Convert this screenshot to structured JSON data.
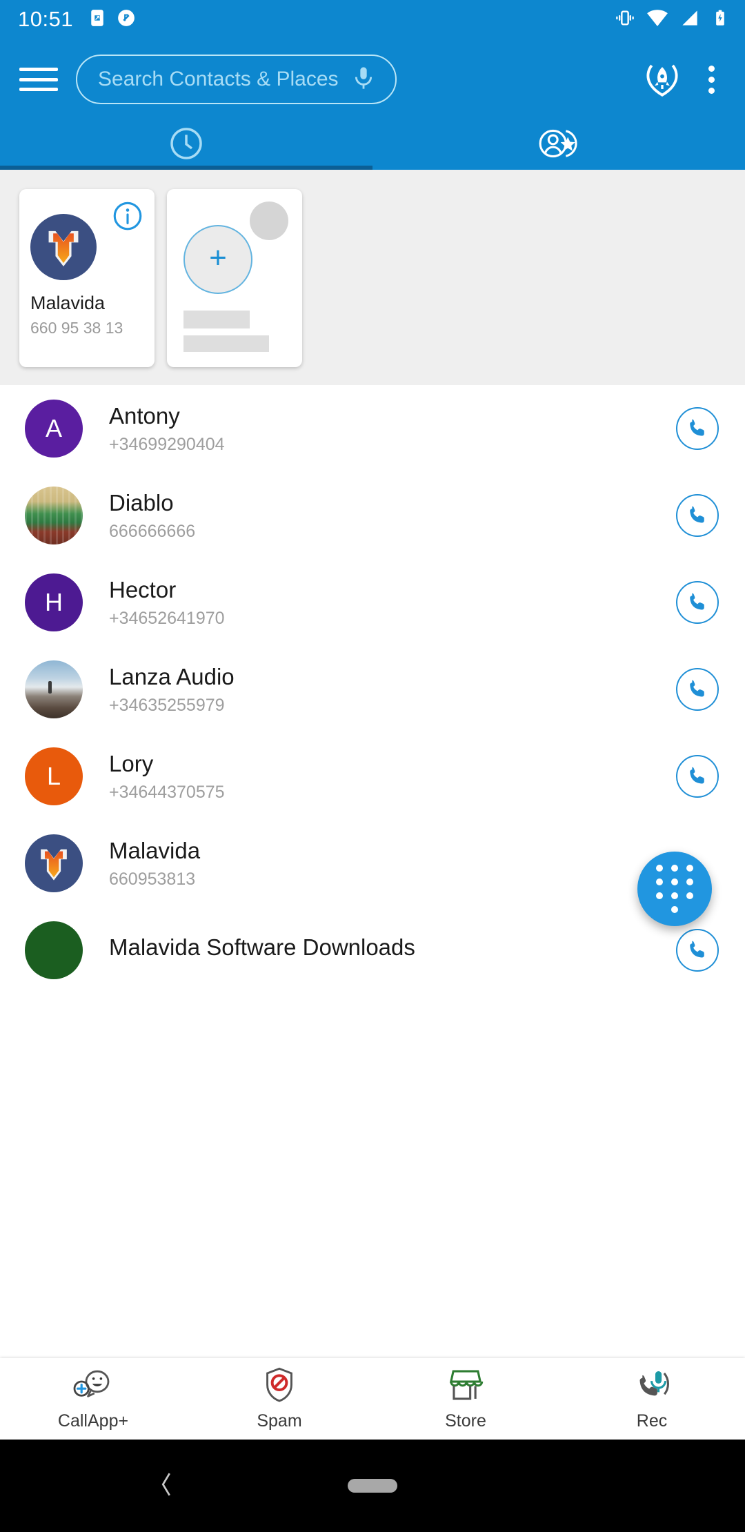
{
  "status_bar": {
    "time": "10:51",
    "left_icons": [
      "screenshot-icon",
      "no-screen-rotation-icon"
    ],
    "right_icons": [
      "vibrate-icon",
      "wifi-icon",
      "cellular-signal-icon",
      "battery-charging-icon"
    ],
    "background": "#0d87cf"
  },
  "header": {
    "menu_icon": "hamburger-menu-icon",
    "search_placeholder": "Search Contacts & Places",
    "mic_icon": "microphone-icon",
    "rocket_icon": "rocket-badge-icon",
    "overflow_icon": "overflow-menu-icon",
    "background": "#0d87cf",
    "placeholder_color": "#a7dcf5"
  },
  "tabs": {
    "items": [
      {
        "name": "recents-tab",
        "icon": "clock-icon",
        "selected": true
      },
      {
        "name": "contacts-tab",
        "icon": "contacts-star-icon",
        "selected": false
      }
    ],
    "indicator_color": "#0b5f95"
  },
  "favorites": {
    "background": "#efefef",
    "cards": [
      {
        "name": "Malavida",
        "phone": "660 95 38 13",
        "avatar_type": "logo",
        "avatar_label": "malavida-logo",
        "info_icon": "info-icon"
      },
      {
        "type": "add-placeholder",
        "add_icon": "plus-icon",
        "name": "",
        "phone": ""
      }
    ]
  },
  "contacts": {
    "rows": [
      {
        "name": "Antony",
        "phone": "+34699290404",
        "avatar_type": "initial",
        "initial": "A",
        "avatar_color": "#5a1ea0",
        "action_icon": "phone-call-icon"
      },
      {
        "name": "Diablo",
        "phone": "666666666",
        "avatar_type": "photo",
        "avatar_label": "diablo-photo",
        "action_icon": "phone-call-icon"
      },
      {
        "name": "Hector",
        "phone": "+34652641970",
        "avatar_type": "initial",
        "initial": "H",
        "avatar_color": "#4d1a92",
        "action_icon": "phone-call-icon"
      },
      {
        "name": "Lanza Audio",
        "phone": "+34635255979",
        "avatar_type": "photo",
        "avatar_label": "lanza-audio-photo",
        "action_icon": "phone-call-icon"
      },
      {
        "name": "Lory",
        "phone": "+34644370575",
        "avatar_type": "initial",
        "initial": "L",
        "avatar_color": "#e85a0c",
        "action_icon": "phone-call-icon"
      },
      {
        "name": "Malavida",
        "phone": "660953813",
        "avatar_type": "logo",
        "avatar_label": "malavida-logo",
        "action_icon": "phone-call-icon"
      },
      {
        "name": "Malavida Software Downloads",
        "phone": "",
        "avatar_type": "initial",
        "initial": "",
        "avatar_color": "#1b5e20",
        "action_icon": "phone-call-icon"
      }
    ]
  },
  "fab": {
    "icon": "dialpad-icon",
    "color": "#2196e0"
  },
  "bottom_nav": {
    "items": [
      {
        "label": "CallApp+",
        "icon": "callapp-plus-icon"
      },
      {
        "label": "Spam",
        "icon": "spam-shield-icon"
      },
      {
        "label": "Store",
        "icon": "store-icon"
      },
      {
        "label": "Rec",
        "icon": "call-recorder-icon"
      }
    ]
  },
  "system_nav": {
    "back_icon": "back-chevron-icon",
    "home_icon": "home-pill-icon",
    "background": "#000000"
  }
}
